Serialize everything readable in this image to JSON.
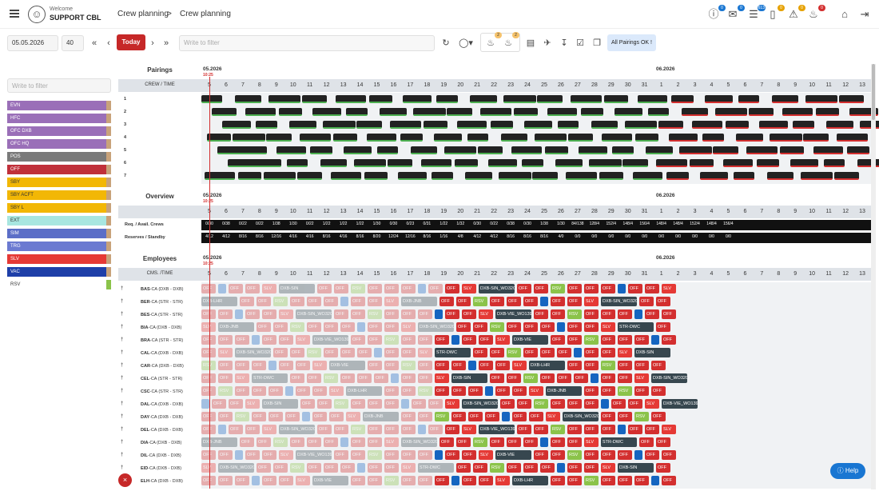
{
  "header": {
    "welcome": "Welcome",
    "user": "SUPPORT CBL",
    "breadcrumb": [
      "Crew planning",
      ">",
      "Crew planning"
    ],
    "badges": {
      "help": "0",
      "mail": "0",
      "list": "613",
      "msg": "0",
      "alert": "0",
      "bell": "0"
    }
  },
  "toolbar": {
    "date": "05.05.2026",
    "days": "40",
    "today": "Today",
    "filter_placeholder": "Write to filter",
    "bell1_count": "2",
    "bell2_count": "2",
    "status": "All Pairings OK !"
  },
  "side": {
    "filter_placeholder": "Write to filter",
    "legend": [
      {
        "label": "EVN",
        "color": "#9a6fb8"
      },
      {
        "label": "HFC",
        "color": "#9a6fb8"
      },
      {
        "label": "OFC DXB",
        "color": "#9a6fb8"
      },
      {
        "label": "OFC HQ",
        "color": "#9a6fb8"
      },
      {
        "label": "POS",
        "color": "#7a7a7a"
      },
      {
        "label": "OFF",
        "color": "#c0303a"
      },
      {
        "label": "SBY",
        "color": "#f2b705"
      },
      {
        "label": "SBY ACFT",
        "color": "#f2b705"
      },
      {
        "label": "SBY L",
        "color": "#f2b705"
      },
      {
        "label": "EXT",
        "color": "#a8e6e0"
      },
      {
        "label": "SIM",
        "color": "#5b6ec7"
      },
      {
        "label": "TRG",
        "color": "#6b7ad1"
      },
      {
        "label": "SLV",
        "color": "#e53935"
      },
      {
        "label": "VAC",
        "color": "#1e3fa8"
      },
      {
        "label": "RSV",
        "color": "#ffffff"
      }
    ]
  },
  "months": {
    "m1": "05.2026",
    "m2": "06.2026",
    "time": "10:25"
  },
  "days": [
    "5",
    "6",
    "7",
    "8",
    "9",
    "10",
    "11",
    "12",
    "13",
    "14",
    "15",
    "16",
    "17",
    "18",
    "19",
    "20",
    "21",
    "22",
    "23",
    "24",
    "25",
    "26",
    "27",
    "28",
    "29",
    "30",
    "31",
    "1",
    "2",
    "3",
    "4",
    "5",
    "6",
    "7",
    "8",
    "9",
    "10",
    "11",
    "12",
    "13"
  ],
  "pairings": {
    "title": "Pairings",
    "col": "CREW / TIME",
    "rows": [
      "1",
      "2",
      "3",
      "4",
      "5",
      "6",
      "7"
    ]
  },
  "overview": {
    "title": "Overview",
    "req_label": "Req. / Avail. Crews",
    "res_label": "Reserves / Standby",
    "req": [
      "0/30",
      "0/38",
      "0/22",
      "0/22",
      "1/38",
      "1/30",
      "0/22",
      "1/22",
      "1/22",
      "1/22",
      "1/30",
      "0/30",
      "0/23",
      "0/31",
      "1/22",
      "1/32",
      "0/30",
      "0/22",
      "0/38",
      "0/30",
      "1/38",
      "1/30",
      "84/138",
      "128/4",
      "152/4",
      "148/4",
      "156/4",
      "148/4",
      "148/4",
      "152/4",
      "148/4",
      "156/4"
    ],
    "res": [
      "4/12",
      "4/12",
      "8/16",
      "8/16",
      "12/16",
      "4/16",
      "4/16",
      "8/16",
      "4/16",
      "8/16",
      "8/20",
      "12/24",
      "12/16",
      "8/16",
      "1/16",
      "4/8",
      "4/12",
      "4/12",
      "8/16",
      "8/16",
      "8/16",
      "4/0",
      "0/0",
      "0/0",
      "0/0",
      "0/0",
      "0/0",
      "0/0",
      "0/0",
      "0/0",
      "0/0",
      "0/0"
    ]
  },
  "employees": {
    "title": "Employees",
    "col": "CMS. /TIME",
    "rows": [
      {
        "id": "BAS",
        "desc": "-CA (DXB - DXB)"
      },
      {
        "id": "BER",
        "desc": "-CA (STR - STR)"
      },
      {
        "id": "BES",
        "desc": "-CA (STR - STR)"
      },
      {
        "id": "BIA",
        "desc": "-CA (DXB - DXB)"
      },
      {
        "id": "BRA",
        "desc": "-CA (STR - STR)"
      },
      {
        "id": "CAL",
        "desc": "-CA (DXB - DXB)"
      },
      {
        "id": "CAR",
        "desc": "-CA (DXB - DXB)"
      },
      {
        "id": "CEL",
        "desc": "-CA (STR - STR)"
      },
      {
        "id": "CSC",
        "desc": "-CA (STR - STR)"
      },
      {
        "id": "DAL",
        "desc": "-CA (DXB - DXB)"
      },
      {
        "id": "DAY",
        "desc": "-CA (DXB - DXB)"
      },
      {
        "id": "DEL",
        "desc": "-CA (DXB - DXB)"
      },
      {
        "id": "DIA",
        "desc": "-CA (DXB - DXB)"
      },
      {
        "id": "DIL",
        "desc": "-CA (DXB - DXB)"
      },
      {
        "id": "EID",
        "desc": "-CA (DXB - DXB)"
      },
      {
        "id": "ELH",
        "desc": "-CA (DXB - DXB)"
      }
    ]
  },
  "duty": {
    "off": "OFF",
    "rsv": "RSV",
    "slv": "SLV",
    "trips": [
      "DXB-SIN_WO320",
      "DXB-LHR",
      "STR-DWC",
      "DXB-VIE_WO139",
      "DXB-JNB",
      "DXB-SIN",
      "DXB-VIE",
      "DXB-SIN_WO320..."
    ]
  },
  "help": "Help",
  "close": "×"
}
